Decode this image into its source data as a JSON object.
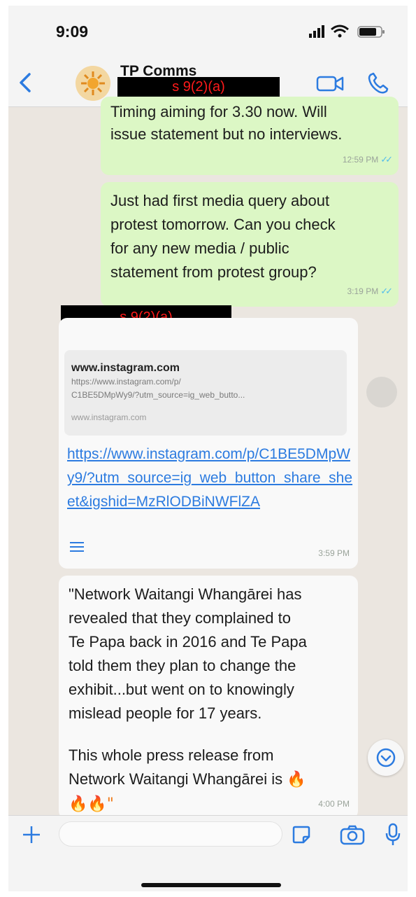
{
  "status_bar": {
    "time": "9:09"
  },
  "header": {
    "contact_name": "TP Comms",
    "redaction_label": "s 9(2)(a)"
  },
  "messages": [
    {
      "direction": "outgoing",
      "text": "Timing aiming for 3.30 now. Will\nissue statement but no interviews.",
      "time": "12:59 PM"
    },
    {
      "direction": "outgoing",
      "text": "Just had first media query about\nprotest tomorrow. Can you check\nfor any new media / public\nstatement from protest group?",
      "time": "3:19 PM"
    },
    {
      "direction": "incoming",
      "sender_redaction": "s 9(2)(a)",
      "preview": {
        "domain": "www.instagram.com",
        "url_line1": "https://www.instagram.com/p/",
        "url_line2": "C1BE5DMpWy9/?utm_source=ig_web_butto...",
        "site": "www.instagram.com"
      },
      "link": "https://www.instagram.com/p/C1BE5DMpWy9/?utm_source=ig_web_button_share_sheet&igshid=MzRlODBiNWFlZA",
      "time": "3:59 PM"
    },
    {
      "direction": "incoming",
      "text": "\"Network Waitangi Whangārei has\nrevealed that they complained to\nTe Papa back in 2016 and Te Papa\ntold them they plan to change the\nexhibit...but went on to knowingly\nmislead people for 17 years.",
      "text2": "This whole press release from\nNetwork Waitangi Whangārei is",
      "emoji_line": "🔥",
      "emoji_tail": "🔥🔥\"",
      "time": "4:00 PM"
    }
  ],
  "input": {
    "placeholder": ""
  },
  "colors": {
    "outgoing_bubble": "#dcf7c5",
    "incoming_bubble": "#f9f9f9",
    "accent": "#2c7be0",
    "redaction_text": "#ff1a1a"
  },
  "icons": [
    "back-chevron-icon",
    "avatar-sun-icon",
    "video-call-icon",
    "phone-call-icon",
    "plus-icon",
    "sticker-icon",
    "camera-icon",
    "microphone-icon",
    "scroll-down-icon",
    "read-receipt-icon"
  ]
}
